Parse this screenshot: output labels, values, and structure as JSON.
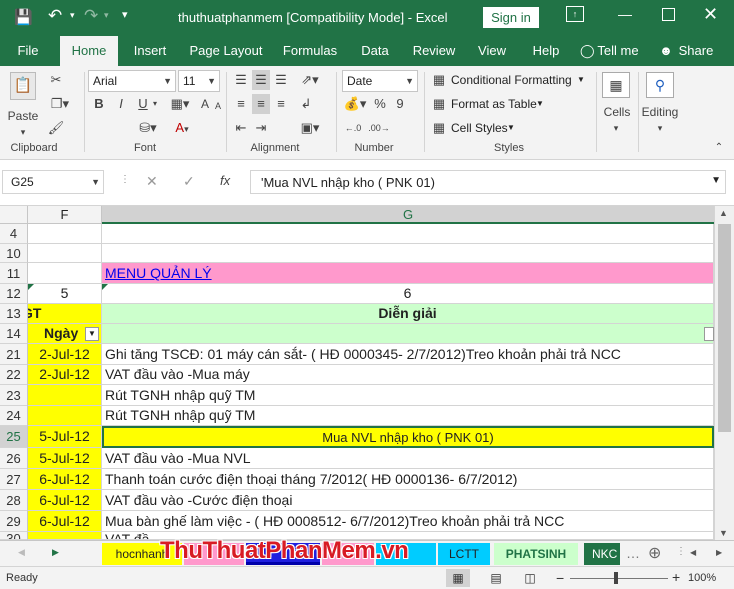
{
  "titlebar": {
    "title": "thuthuatphanmem  [Compatibility Mode]  -  Excel",
    "sign_in": "Sign in"
  },
  "ribbon_tabs": [
    "File",
    "Home",
    "Insert",
    "Page Layout",
    "Formulas",
    "Data",
    "Review",
    "View",
    "Help"
  ],
  "tell_me": "Tell me",
  "share": "Share",
  "clipboard": {
    "paste": "Paste",
    "label": "Clipboard"
  },
  "font": {
    "name": "Arial",
    "size": "11",
    "label": "Font",
    "bold": "B",
    "italic": "I",
    "underline": "U"
  },
  "alignment": {
    "label": "Alignment"
  },
  "number": {
    "format": "Date",
    "label": "Number",
    "percent": "%",
    "comma": "9"
  },
  "styles": {
    "conditional": "Conditional Formatting",
    "table": "Format as Table",
    "cell": "Cell Styles",
    "label": "Styles"
  },
  "cells": {
    "label": "Cells"
  },
  "editing": {
    "label": "Editing"
  },
  "formula_bar": {
    "name_box": "G25",
    "content": "'Mua NVL nhập kho ( PNK 01)",
    "fx": "fx"
  },
  "columns": {
    "f": "F",
    "g": "G"
  },
  "rows": [
    {
      "num": "4",
      "f": "",
      "g": ""
    },
    {
      "num": "10",
      "f": "",
      "g": ""
    },
    {
      "num": "11",
      "f": "",
      "g": "MENU QUẢN LÝ"
    },
    {
      "num": "12",
      "f": "5",
      "g": "6"
    },
    {
      "num": "13",
      "f": "GT",
      "g": "Diễn giải"
    },
    {
      "num": "14",
      "f": "Ngày",
      "g": ""
    },
    {
      "num": "21",
      "f": "2-Jul-12",
      "g": "Ghi tăng TSCĐ: 01 máy cán sắt- ( HĐ 0000345- 2/7/2012)Treo khoản phải trả NCC"
    },
    {
      "num": "22",
      "f": "2-Jul-12",
      "g": "VAT đầu vào -Mua máy"
    },
    {
      "num": "23",
      "f": "",
      "g": "Rút TGNH nhập quỹ TM"
    },
    {
      "num": "24",
      "f": "",
      "g": "Rút TGNH nhập quỹ TM"
    },
    {
      "num": "25",
      "f": "5-Jul-12",
      "g": "Mua NVL nhập kho ( PNK 01)"
    },
    {
      "num": "26",
      "f": "5-Jul-12",
      "g": "VAT đầu vào -Mua NVL"
    },
    {
      "num": "27",
      "f": "6-Jul-12",
      "g": "Thanh toán cước điện thoại tháng 7/2012( HĐ 0000136- 6/7/2012)"
    },
    {
      "num": "28",
      "f": "6-Jul-12",
      "g": "VAT đầu vào -Cước điện thoại"
    },
    {
      "num": "29",
      "f": "6-Jul-12",
      "g": "Mua bàn ghế làm việc - ( HĐ 0008512- 6/7/2012)Treo khoản phải trả NCC"
    },
    {
      "num": "30",
      "f": "",
      "g": "VAT đầ"
    }
  ],
  "sheet_tabs": [
    "hocnhanh",
    "LCTT",
    "PHATSINH",
    "NKC"
  ],
  "watermark": "ThuThuatPhanMem.vn",
  "status": {
    "ready": "Ready",
    "zoom": "100%"
  },
  "colors": {
    "excel_green": "#217346",
    "yellow": "#ffff00",
    "light_green": "#ccffcc",
    "pink": "#ff99cc"
  }
}
